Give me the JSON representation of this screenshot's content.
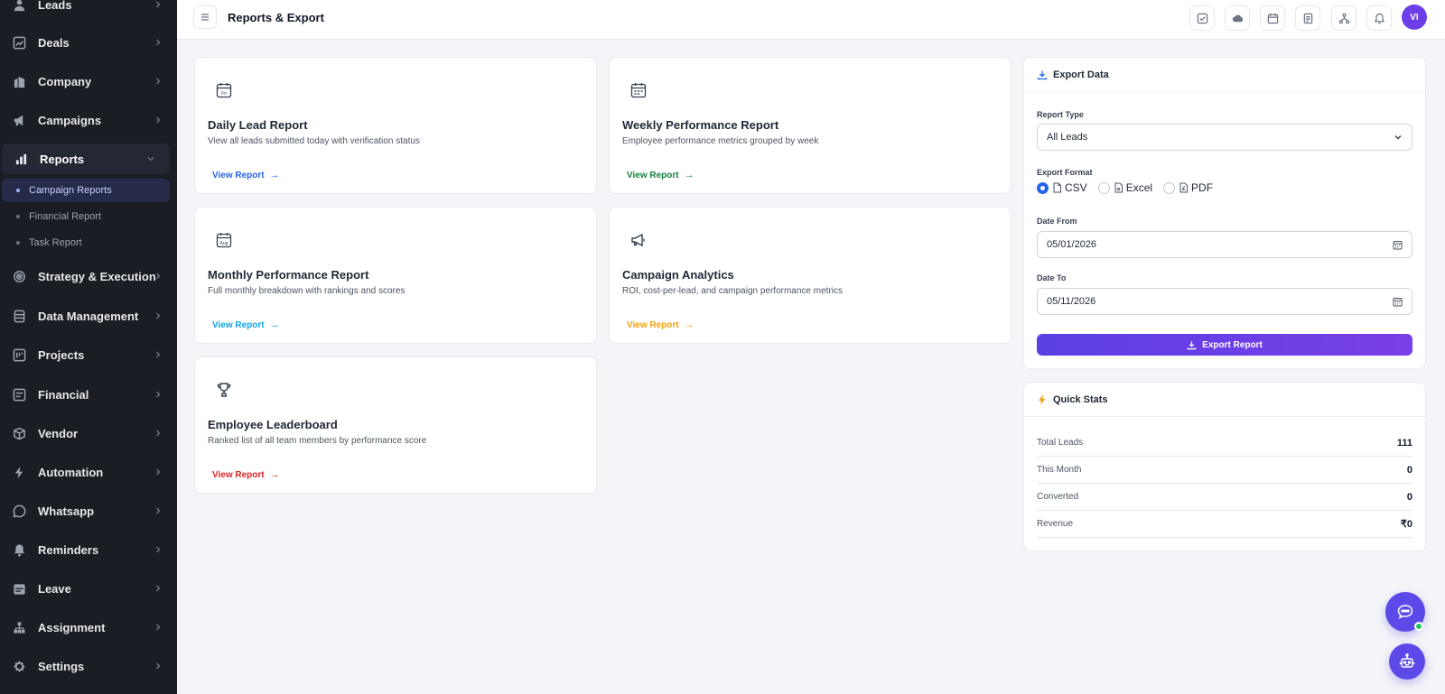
{
  "sidebar": {
    "items": [
      {
        "label": "Leads",
        "icon": "users-icon"
      },
      {
        "label": "Deals",
        "icon": "chart-line-icon"
      },
      {
        "label": "Company",
        "icon": "building-icon"
      },
      {
        "label": "Campaigns",
        "icon": "megaphone-icon"
      },
      {
        "label": "Reports",
        "icon": "bar-chart-icon"
      },
      {
        "label": "Strategy & Execution",
        "icon": "target-icon"
      },
      {
        "label": "Data Management",
        "icon": "database-icon"
      },
      {
        "label": "Projects",
        "icon": "project-icon"
      },
      {
        "label": "Financial",
        "icon": "wallet-icon"
      },
      {
        "label": "Vendor",
        "icon": "box-icon"
      },
      {
        "label": "Automation",
        "icon": "bolt-icon"
      },
      {
        "label": "Whatsapp",
        "icon": "whatsapp-icon"
      },
      {
        "label": "Reminders",
        "icon": "bell-icon"
      },
      {
        "label": "Leave",
        "icon": "calendar-icon"
      },
      {
        "label": "Assignment",
        "icon": "hierarchy-icon"
      },
      {
        "label": "Settings",
        "icon": "gear-icon"
      }
    ],
    "subitems": [
      {
        "label": "Campaign Reports"
      },
      {
        "label": "Financial Report"
      },
      {
        "label": "Task Report"
      }
    ]
  },
  "header": {
    "title": "Reports & Export",
    "avatar": "VI"
  },
  "reports": [
    {
      "title": "Daily Lead Report",
      "desc": "View all leads submitted today with verification status",
      "link": "View Report",
      "color": "#2563eb",
      "icon": "calendar-day-icon"
    },
    {
      "title": "Weekly Performance Report",
      "desc": "Employee performance metrics grouped by week",
      "link": "View Report",
      "color": "#15803d",
      "icon": "calendar-week-icon"
    },
    {
      "title": "Monthly Performance Report",
      "desc": "Full monthly breakdown with rankings and scores",
      "link": "View Report",
      "color": "#0ea5e9",
      "icon": "calendar-month-icon"
    },
    {
      "title": "Campaign Analytics",
      "desc": "ROI, cost-per-lead, and campaign performance metrics",
      "link": "View Report",
      "color": "#f59e0b",
      "icon": "megaphone-icon"
    },
    {
      "title": "Employee Leaderboard",
      "desc": "Ranked list of all team members by performance score",
      "link": "View Report",
      "color": "#dc2626",
      "icon": "trophy-icon"
    }
  ],
  "export": {
    "title": "Export Data",
    "report_type_label": "Report Type",
    "report_type_value": "All Leads",
    "format_label": "Export Format",
    "formats": [
      "CSV",
      "Excel",
      "PDF"
    ],
    "selected_format": "CSV",
    "date_from_label": "Date From",
    "date_from": "05/01/2026",
    "date_to_label": "Date To",
    "date_to": "05/11/2026",
    "button": "Export Report"
  },
  "stats": {
    "title": "Quick Stats",
    "rows": [
      {
        "label": "Total Leads",
        "value": "111"
      },
      {
        "label": "This Month",
        "value": "0"
      },
      {
        "label": "Converted",
        "value": "0"
      },
      {
        "label": "Revenue",
        "value": "₹0"
      }
    ]
  },
  "colors": {
    "accent": "#5b3fe3",
    "sidebar_bg": "#1a1d24",
    "online": "#22c55e"
  }
}
